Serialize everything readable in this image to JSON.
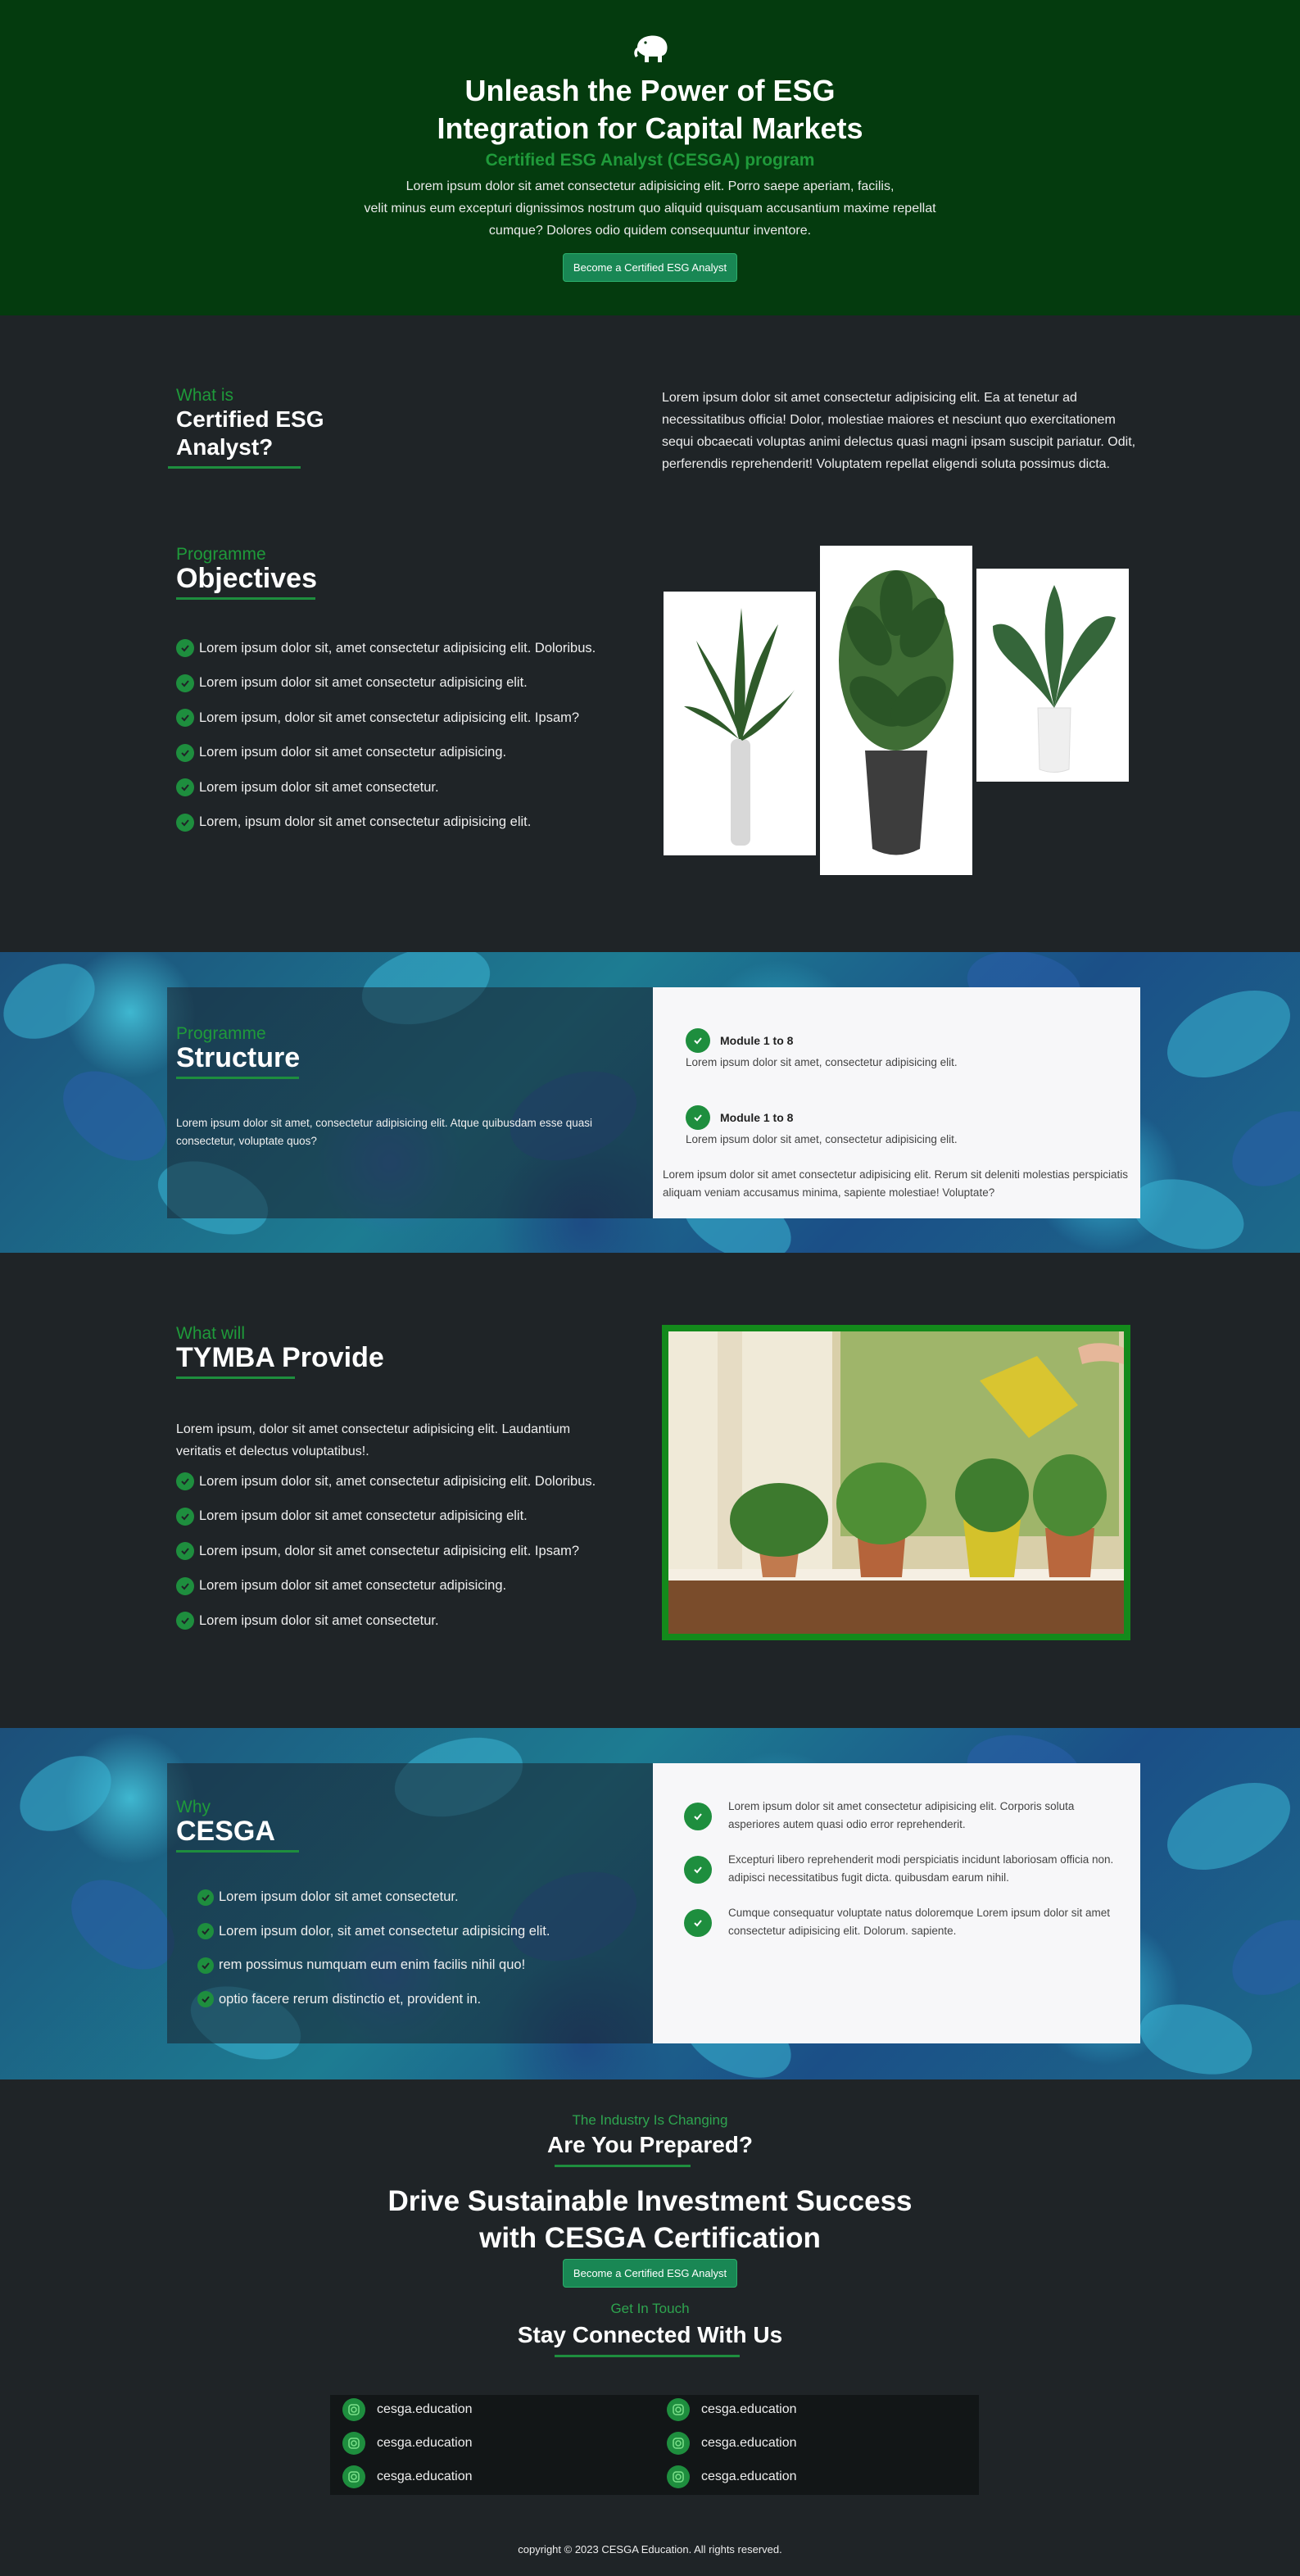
{
  "hero": {
    "title_line1": "Unleash the Power of ESG",
    "title_line2": "Integration for Capital Markets",
    "subtitle": "Certified ESG Analyst (CESGA) program",
    "desc_line1": "Lorem ipsum dolor sit amet consectetur adipisicing elit. Porro saepe aperiam, facilis,",
    "desc_line2": "velit minus eum excepturi dignissimos nostrum quo aliquid quisquam accusantium maxime repellat",
    "desc_line3": "cumque? Dolores odio quidem consequuntur inventore.",
    "cta": "Become a Certified ESG Analyst"
  },
  "what_is": {
    "small": "What is",
    "title_line1": "Certified ESG",
    "title_line2": "Analyst?",
    "text": "Lorem ipsum dolor sit amet consectetur adipisicing elit. Ea at tenetur ad necessitatibus officia! Dolor, molestiae maiores et nesciunt quo exercitationem sequi obcaecati voluptas animi delectus quasi magni ipsam suscipit pariatur. Odit, perferendis reprehenderit! Voluptatem repellat eligendi soluta possimus dicta."
  },
  "objectives": {
    "small": "Programme",
    "title": "Objectives",
    "items": [
      "Lorem ipsum dolor sit, amet consectetur adipisicing elit. Doloribus.",
      "Lorem ipsum dolor sit amet consectetur adipisicing elit.",
      "Lorem ipsum, dolor sit amet consectetur adipisicing elit. Ipsam?",
      "Lorem ipsum dolor sit amet consectetur adipisicing.",
      "Lorem ipsum dolor sit amet consectetur.",
      "Lorem, ipsum dolor sit amet consectetur adipisicing elit."
    ]
  },
  "structure": {
    "small": "Programme",
    "title": "Structure",
    "text": "Lorem ipsum dolor sit amet, consectetur adipisicing elit. Atque quibusdam esse quasi consectetur, voluptate quos?",
    "modules": [
      {
        "title": "Module 1 to 8",
        "text": "Lorem ipsum dolor sit amet, consectetur adipisicing elit."
      },
      {
        "title": "Module 1 to 8",
        "text": "Lorem ipsum dolor sit amet, consectetur adipisicing elit."
      }
    ],
    "footer_text": "Lorem ipsum dolor sit amet consectetur adipisicing elit. Rerum sit deleniti molestias perspiciatis aliquam veniam accusamus minima, sapiente molestiae! Voluptate?"
  },
  "provide": {
    "small": "What will",
    "title": "TYMBA Provide",
    "intro": "Lorem ipsum, dolor sit amet consectetur adipisicing elit. Laudantium veritatis et delectus voluptatibus!.",
    "items": [
      "Lorem ipsum dolor sit, amet consectetur adipisicing elit. Doloribus.",
      "Lorem ipsum dolor sit amet consectetur adipisicing elit.",
      "Lorem ipsum, dolor sit amet consectetur adipisicing elit. Ipsam?",
      "Lorem ipsum dolor sit amet consectetur adipisicing.",
      "Lorem ipsum dolor sit amet consectetur."
    ]
  },
  "why": {
    "small": "Why",
    "title": "CESGA",
    "items": [
      "Lorem ipsum dolor sit amet consectetur.",
      "Lorem ipsum dolor, sit amet consectetur adipisicing elit.",
      "rem possimus numquam eum enim facilis nihil quo!",
      "optio facere rerum distinctio et, provident in."
    ],
    "right_items": [
      "Lorem ipsum dolor sit amet consectetur adipisicing elit. Corporis soluta asperiores autem quasi odio error reprehenderit.",
      "Excepturi libero reprehenderit modi perspiciatis incidunt laboriosam officia non. adipisci necessitatibus fugit dicta. quibusdam earum nihil.",
      "Cumque consequatur voluptate natus doloremque Lorem ipsum dolor sit amet consectetur adipisicing elit. Dolorum. sapiente."
    ]
  },
  "industry": {
    "small": "The Industry Is Changing",
    "title": "Are You Prepared?",
    "headline_line1": "Drive Sustainable Investment Success",
    "headline_line2": "with CESGA Certification",
    "cta": "Become a Certified ESG Analyst"
  },
  "contact": {
    "small": "Get In Touch",
    "title": "Stay Connected With Us",
    "links": [
      "cesga.education",
      "cesga.education",
      "cesga.education",
      "cesga.education",
      "cesga.education",
      "cesga.education"
    ]
  },
  "footer": {
    "copyright": "copyright © 2023 CESGA Education. All rights reserved."
  },
  "colors": {
    "hero_bg": "#043b0e",
    "page_bg": "#1f2427",
    "accent": "#1e8e3e"
  }
}
